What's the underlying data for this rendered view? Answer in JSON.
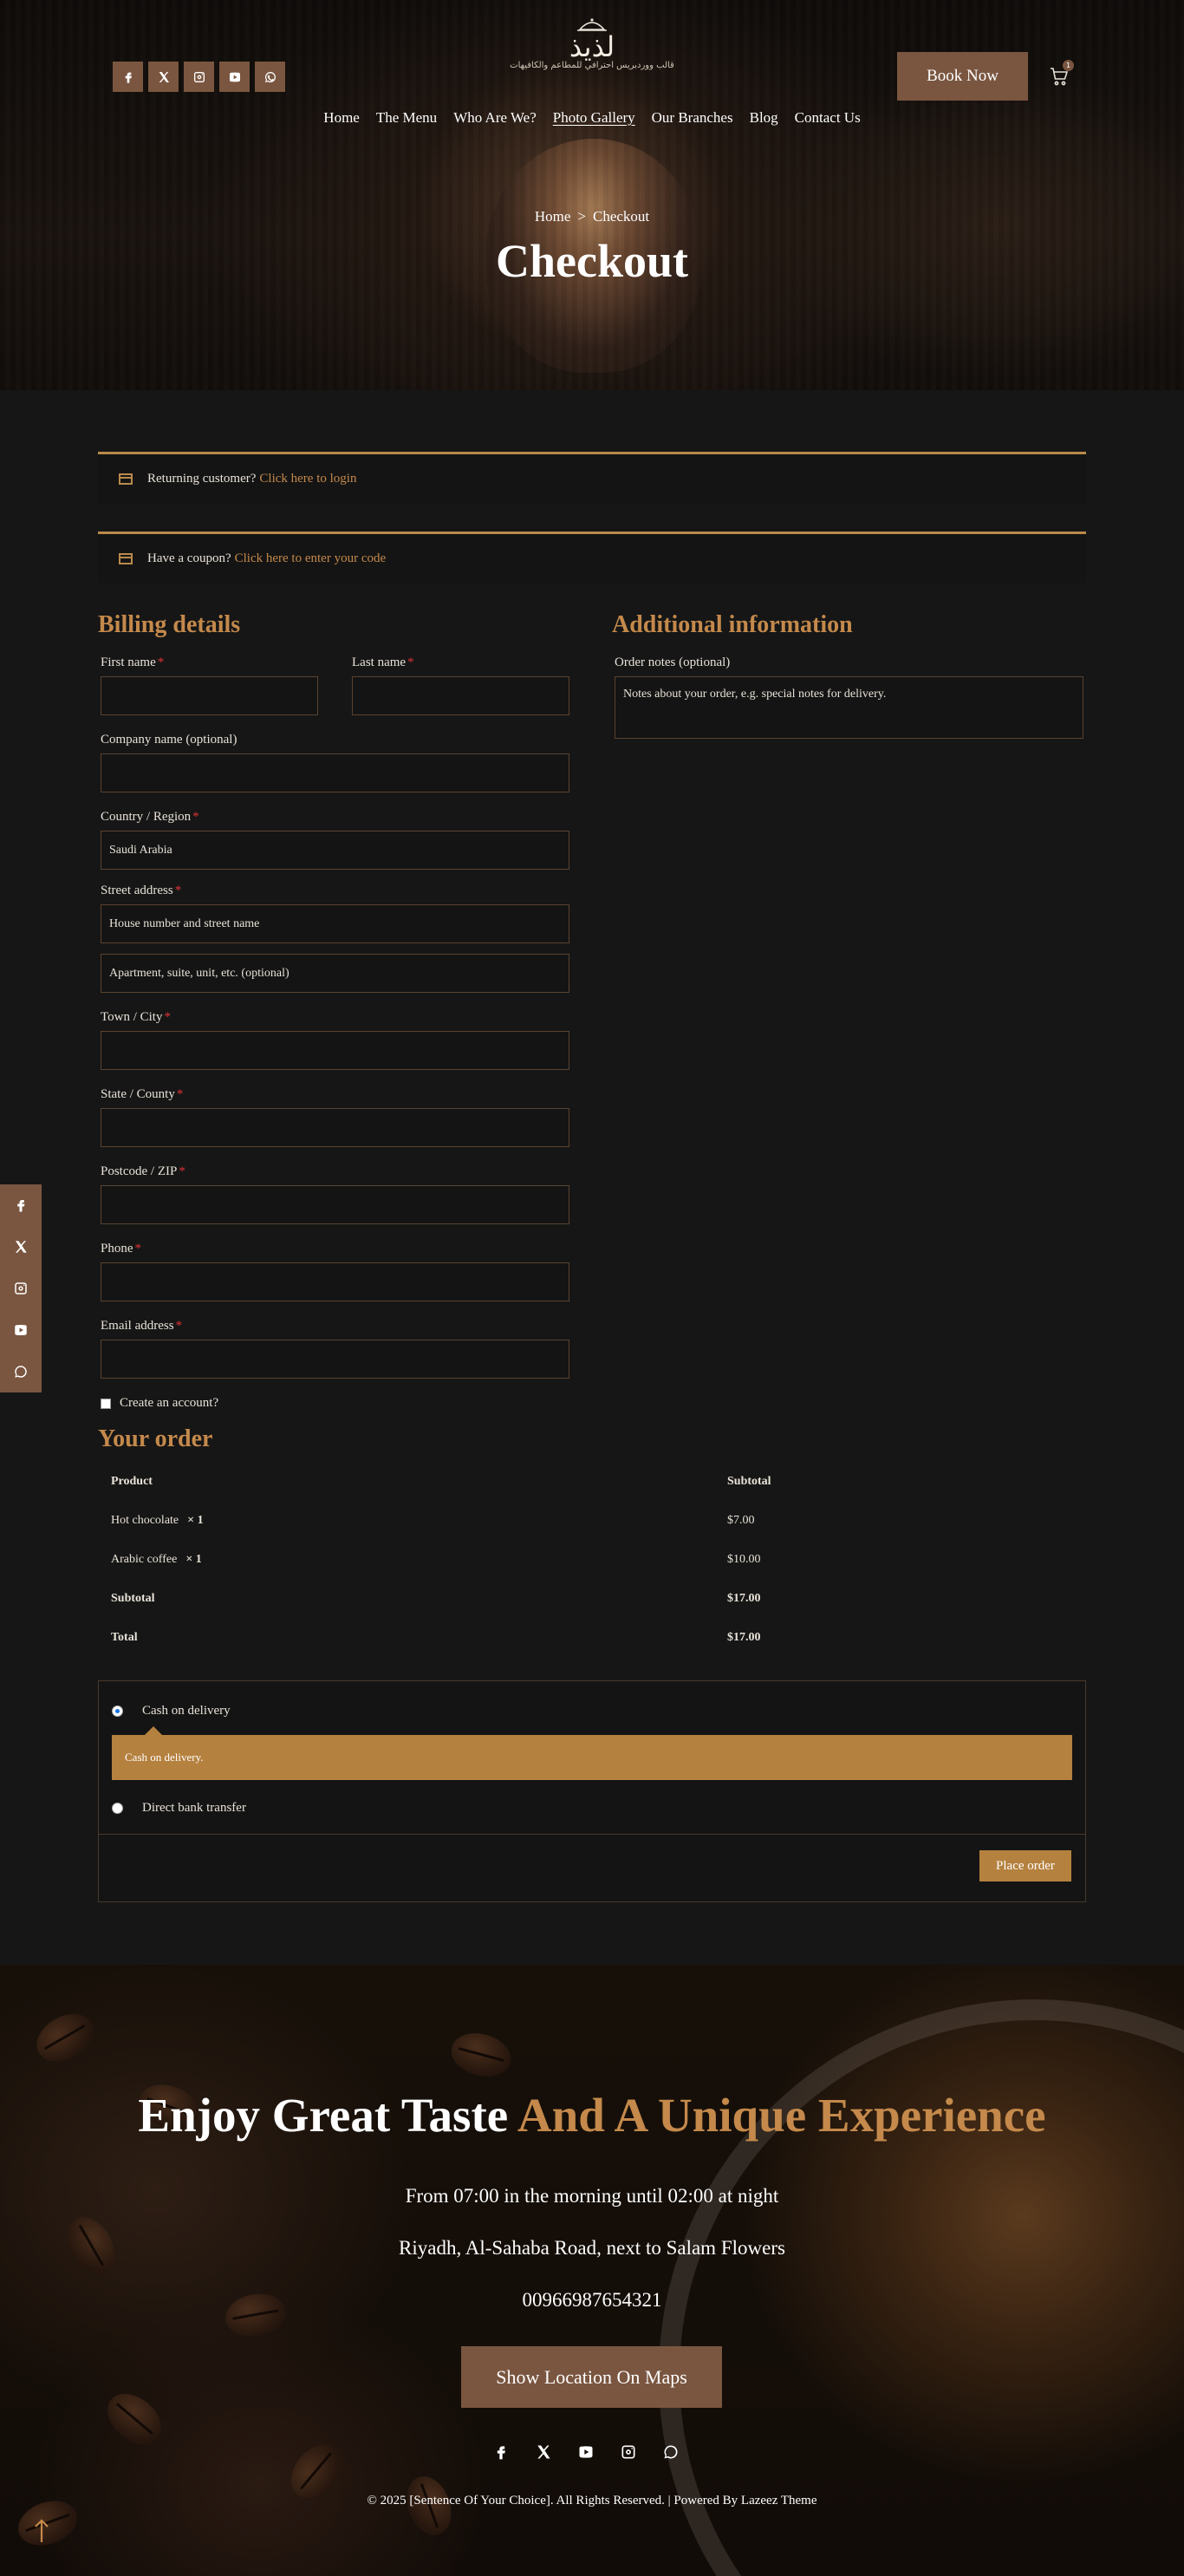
{
  "header": {
    "logo_text": "لذيذ",
    "logo_tagline": "قالب ووردبريس احترافي للمطاعم والكافيهات",
    "book_now": "Book Now",
    "cart_count": "1",
    "social": [
      "facebook-icon",
      "x-icon",
      "instagram-icon",
      "youtube-icon",
      "whatsapp-icon"
    ]
  },
  "nav": [
    "Home",
    "The Menu",
    "Who Are We?",
    "Photo Gallery",
    "Our Branches",
    "Blog",
    "Contact Us"
  ],
  "breadcrumb": {
    "home": "Home",
    "separator": ">",
    "current": "Checkout"
  },
  "page_title": "Checkout",
  "notices": {
    "returning_text": "Returning customer?",
    "returning_link": "Click here to login",
    "coupon_text": "Have a coupon?",
    "coupon_link": "Click here to enter your code"
  },
  "billing": {
    "title": "Billing details",
    "first_name": "First name",
    "last_name": "Last name",
    "company": "Company name (optional)",
    "country": "Country / Region",
    "country_value": "Saudi Arabia",
    "street": "Street address",
    "street_placeholder": "House number and street name",
    "street2_placeholder": "Apartment, suite, unit, etc. (optional)",
    "city": "Town / City",
    "state": "State / County",
    "postcode": "Postcode / ZIP",
    "phone": "Phone",
    "email": "Email address",
    "create_account": "Create an account?",
    "required_mark": "*"
  },
  "additional": {
    "title": "Additional information",
    "notes_label": "Order notes (optional)",
    "notes_placeholder": "Notes about your order, e.g. special notes for delivery."
  },
  "order": {
    "title": "Your order",
    "col_product": "Product",
    "col_subtotal": "Subtotal",
    "items": [
      {
        "name": "Hot chocolate",
        "qty": "× 1",
        "price": "$7.00"
      },
      {
        "name": "Arabic coffee",
        "qty": "× 1",
        "price": "$10.00"
      }
    ],
    "subtotal_label": "Subtotal",
    "subtotal": "$17.00",
    "total_label": "Total",
    "total": "$17.00"
  },
  "payment": {
    "cod": "Cash on delivery",
    "cod_desc": "Cash on delivery.",
    "bank": "Direct bank transfer",
    "place_order": "Place order"
  },
  "footer": {
    "headline_1": "Enjoy Great Taste",
    "headline_2": "And A Unique Experience",
    "hours": "From 07:00 in the morning until 02:00 at night",
    "address": "Riyadh, Al-Sahaba Road, next to Salam Flowers",
    "phone": "00966987654321",
    "map_button": "Show Location On Maps",
    "copyright": "© 2025 [Sentence Of Your Choice]. All Rights Reserved. | Powered By Lazeez Theme"
  },
  "colors": {
    "accent": "#c4894b",
    "brand_brown": "#7a5640",
    "gold_button": "#b5813f",
    "background": "#161616"
  }
}
